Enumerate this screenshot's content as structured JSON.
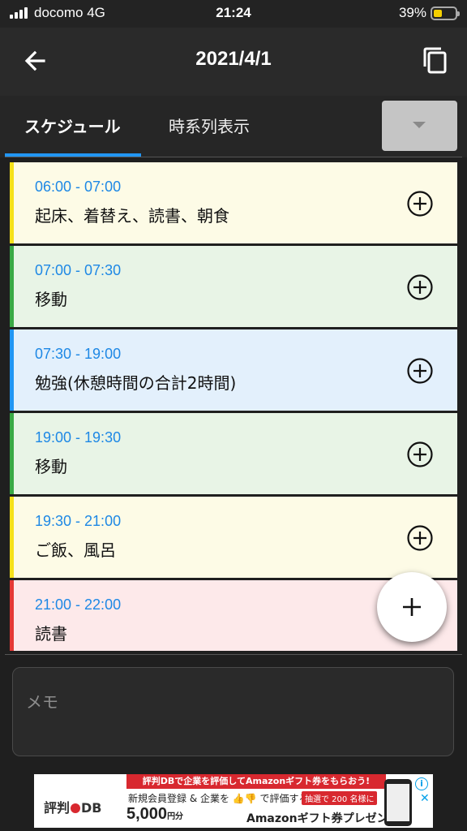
{
  "status_bar": {
    "carrier": "docomo  4G",
    "time": "21:24",
    "battery_percent_text": "39%",
    "battery_level": 0.39,
    "battery_color": "#f5d000"
  },
  "app_bar": {
    "title": "2021/4/1",
    "back_icon": "arrow-left-icon",
    "copy_icon": "copy-icon"
  },
  "tabs": [
    {
      "label": "スケジュール",
      "active": true
    },
    {
      "label": "時系列表示",
      "active": false
    }
  ],
  "schedule": [
    {
      "time": "06:00 - 07:00",
      "title": "起床、着替え、読書、朝食",
      "bg": "#fdfbe6",
      "accent": "#f5e11a"
    },
    {
      "time": "07:00 - 07:30",
      "title": "移動",
      "bg": "#e8f4e6",
      "accent": "#3aa945"
    },
    {
      "time": "07:30 - 19:00",
      "title": "勉強(休憩時間の合計2時間)",
      "bg": "#e3f0fc",
      "accent": "#2196f3"
    },
    {
      "time": "19:00 - 19:30",
      "title": "移動",
      "bg": "#e8f4e6",
      "accent": "#3aa945"
    },
    {
      "time": "19:30 - 21:00",
      "title": "ご飯、風呂",
      "bg": "#fdfbe6",
      "accent": "#f5e11a"
    },
    {
      "time": "21:00 - 22:00",
      "title": "読書",
      "bg": "#fde9ea",
      "accent": "#e53935"
    }
  ],
  "fab_icon": "plus-icon",
  "memo": {
    "placeholder": "メモ"
  },
  "ad": {
    "top_text": "評判DBで企業を評価してAmazonギフト券をもらおう!",
    "logo_left": "評判",
    "logo_right": "DB",
    "line2": "新規会員登録 & 企業を 👍👎 で評価すると",
    "badge": "抽選で 200 名様に",
    "amount": "5,000",
    "unit": "円分",
    "line3_rest": "Amazonギフト券プレゼント!",
    "info": "i",
    "close": "✕"
  }
}
